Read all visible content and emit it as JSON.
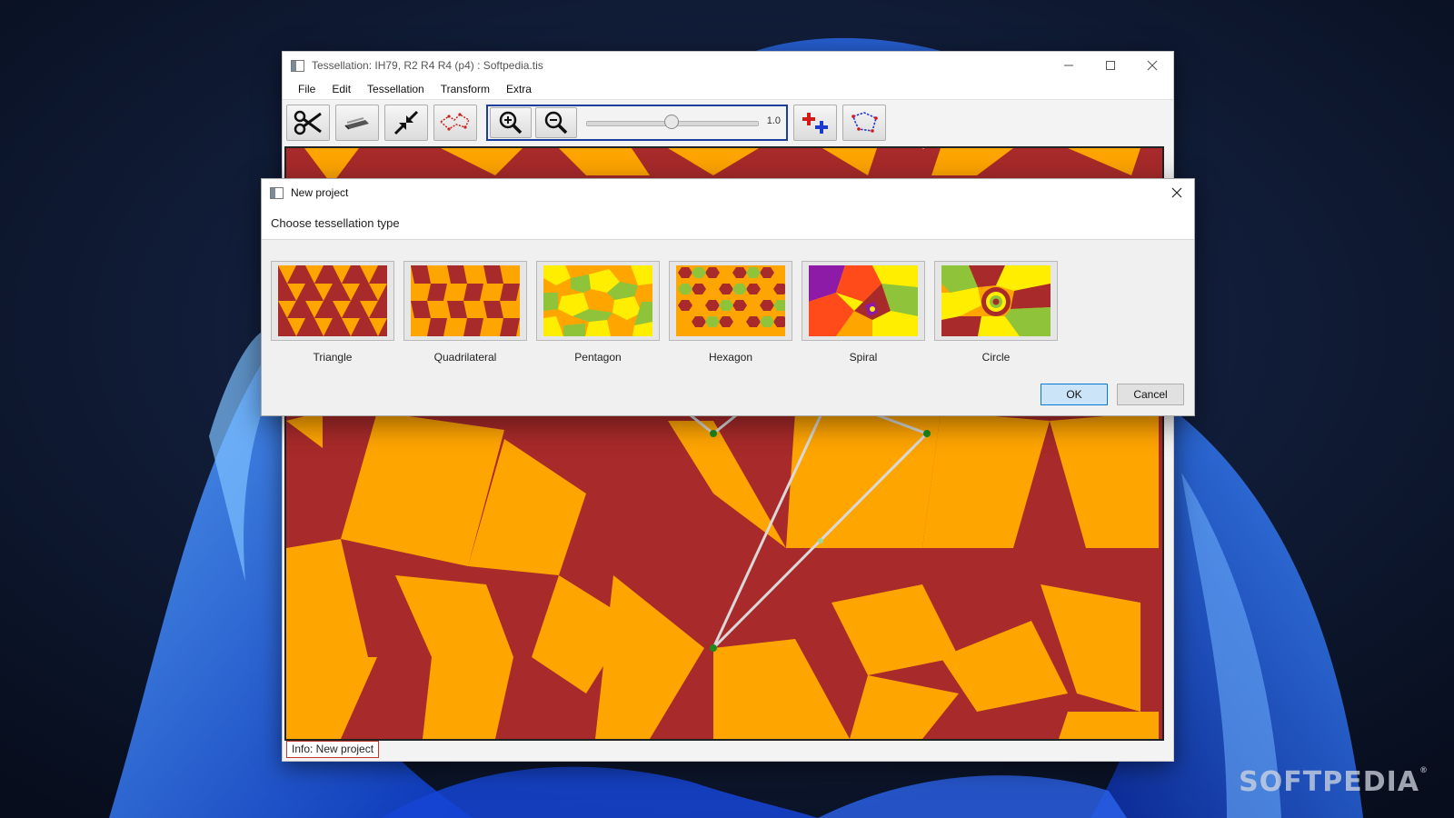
{
  "window": {
    "title": "Tessellation: IH79,   R2 R4 R4 (p4)  :  Softpedia.tis",
    "controls": [
      "minimize-icon",
      "maximize-icon",
      "close-icon"
    ]
  },
  "menu": [
    "File",
    "Edit",
    "Tessellation",
    "Transform",
    "Extra"
  ],
  "toolbar": {
    "buttons": [
      "scissors-icon",
      "eraser-icon",
      "collapse-arrows-icon",
      "edge-points-icon",
      "zoom-in-icon",
      "zoom-out-icon",
      "add-point-icon",
      "polygon-icon"
    ],
    "zoom_value": "1.0",
    "zoom_fraction": 0.5
  },
  "canvas": {
    "colors": {
      "primary": "#a82a2a",
      "secondary": "#ffa500",
      "lines": "#d9d9d9",
      "points": "#1e8a1e"
    }
  },
  "status": {
    "text": "Info: New project"
  },
  "dialog": {
    "title": "New project",
    "prompt": "Choose tessellation type",
    "types": [
      {
        "label": "Triangle"
      },
      {
        "label": "Quadrilateral"
      },
      {
        "label": "Pentagon"
      },
      {
        "label": "Hexagon"
      },
      {
        "label": "Spiral"
      },
      {
        "label": "Circle"
      }
    ],
    "ok_label": "OK",
    "cancel_label": "Cancel"
  },
  "watermark": {
    "text": "SOFTPEDIA",
    "mark": "®"
  }
}
